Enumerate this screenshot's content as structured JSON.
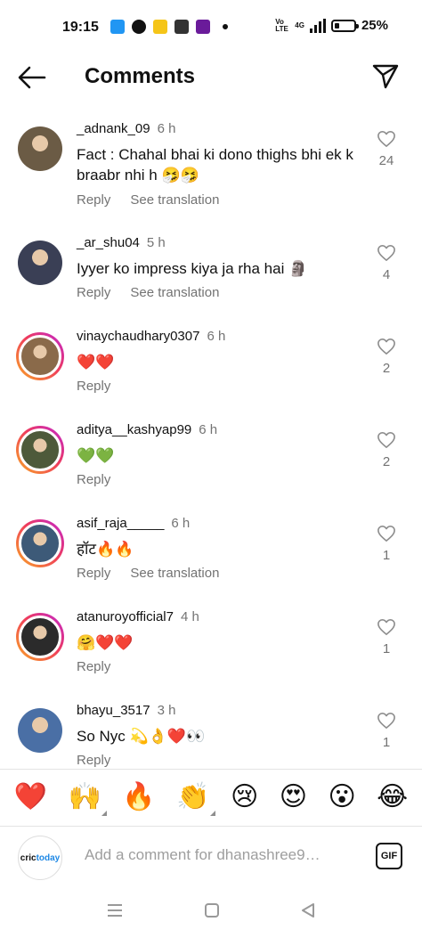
{
  "status_bar": {
    "time": "19:15",
    "network_small": "Vo LTE",
    "network_type": "4G",
    "battery": "25%"
  },
  "header": {
    "title": "Comments",
    "back_icon": "arrow-left-icon",
    "share_icon": "paper-plane-icon"
  },
  "comments": [
    {
      "username": "_adnank_09",
      "time": "6 h",
      "text": "Fact : Chahal bhai ki dono thighs bhi ek k braabr nhi h 🤧🤧",
      "reply": "Reply",
      "translate": "See translation",
      "likes": "24",
      "ring": false
    },
    {
      "username": "_ar_shu04",
      "time": "5 h",
      "text": "Iyyer ko impress kiya ja rha hai 🗿",
      "reply": "Reply",
      "translate": "See translation",
      "likes": "4",
      "ring": false
    },
    {
      "username": "vinaychaudhary0307",
      "time": "6 h",
      "text": "❤️❤️",
      "reply": "Reply",
      "translate": "",
      "likes": "2",
      "ring": true
    },
    {
      "username": "aditya__kashyap99",
      "time": "6 h",
      "text": "💚💚",
      "reply": "Reply",
      "translate": "",
      "likes": "2",
      "ring": true
    },
    {
      "username": "asif_raja_____",
      "time": "6 h",
      "text": "हॉट🔥🔥",
      "reply": "Reply",
      "translate": "See translation",
      "likes": "1",
      "ring": true
    },
    {
      "username": "atanuroyofficial7",
      "time": "4 h",
      "text": "🤗❤️❤️",
      "reply": "Reply",
      "translate": "",
      "likes": "1",
      "ring": true
    },
    {
      "username": "bhayu_3517",
      "time": "3 h",
      "text": "So Nyc 💫👌❤️👀",
      "reply": "Reply",
      "translate": "",
      "likes": "1",
      "ring": false
    }
  ],
  "emoji_bar": [
    "❤️",
    "🙌",
    "🔥",
    "👏",
    "😢",
    "😍",
    "😮",
    "😂"
  ],
  "composer": {
    "avatar_text": "cric",
    "avatar_text_accent": "today",
    "placeholder": "Add a comment for dhanashree9…",
    "gif_label": "GIF"
  },
  "colors": {
    "accent_ring_start": "#f9a825",
    "accent_ring_end": "#c026d3",
    "secondary_text": "#737373",
    "heart_red": "#e53935"
  }
}
